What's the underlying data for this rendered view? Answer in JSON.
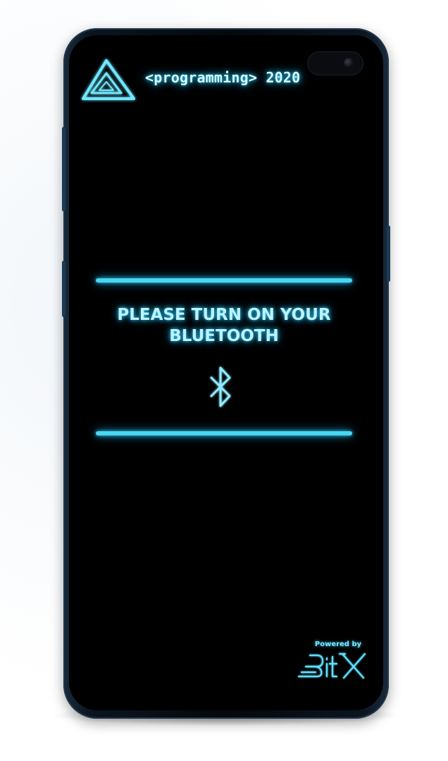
{
  "header": {
    "title": "<programming> 2020"
  },
  "prompt": {
    "message": "PLEASE TURN ON YOUR BLUETOOTH",
    "icon": "bluetooth-icon"
  },
  "footer": {
    "powered_by": "Powered by",
    "brand_logo": "bitx-logo"
  },
  "theme": {
    "accent": "#4ad6f0",
    "text": "#bdf2ff",
    "background": "#000000"
  }
}
